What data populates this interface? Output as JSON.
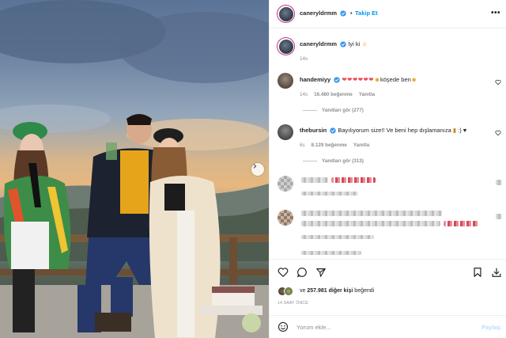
{
  "post": {
    "author": "caneryldrmm",
    "follow_label": "Takip Et",
    "separator": "•",
    "more_label": "•••",
    "caption": "İyi ki",
    "caption_emoji": "☺",
    "caption_time": "14s"
  },
  "comments": [
    {
      "user": "handemiyy",
      "text_suffix": "köşede ben",
      "emojis": "❤❤❤❤❤❤",
      "time": "14s",
      "likes": "16.480 beğenme",
      "reply": "Yanıtla",
      "view_replies": "Yanıtları gör (277)"
    },
    {
      "user": "thebursin",
      "text": "Bayılıyorum size!! Ve beni hep dışlamanıza",
      "text_suffix": ":) ♥",
      "time": "6s",
      "likes": "8.129 beğenme",
      "reply": "Yanıtla",
      "view_replies": "Yanıtları gör (313)"
    }
  ],
  "footer": {
    "likes_prefix": "ve",
    "likes_count": "257.981 diğer kişi",
    "likes_suffix": "beğendi",
    "time_ago": "14 SAAT ÖNCE",
    "comment_placeholder": "Yorum ekle...",
    "post_label": "Paylaş"
  },
  "icons": {
    "verified": "verified-badge-icon",
    "like": "heart-icon",
    "comment": "comment-icon",
    "share": "send-icon",
    "save": "bookmark-icon",
    "download": "download-icon",
    "emoji": "emoji-icon",
    "next": "chevron-right-icon"
  },
  "colors": {
    "accent": "#0095f6",
    "verified": "#3897f0",
    "heart": "#ed4956",
    "muted": "#8e8e8e"
  }
}
